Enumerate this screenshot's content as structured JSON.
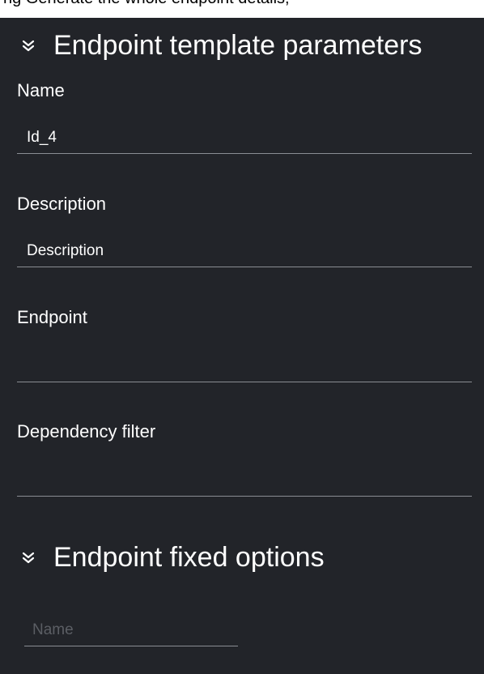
{
  "top_fragment": "ng Generate the whole endpoint details,",
  "sections": {
    "template": {
      "title": "Endpoint template parameters",
      "icon": "chevrons-down-icon"
    },
    "fixed": {
      "title": "Endpoint fixed options",
      "icon": "chevrons-down-icon"
    }
  },
  "fields": {
    "name": {
      "label": "Name",
      "value": "Id_4"
    },
    "description": {
      "label": "Description",
      "value": "Description"
    },
    "endpoint": {
      "label": "Endpoint",
      "value": ""
    },
    "dependency_filter": {
      "label": "Dependency filter",
      "value": ""
    }
  },
  "fixed_options": {
    "name_placeholder": "Name"
  }
}
